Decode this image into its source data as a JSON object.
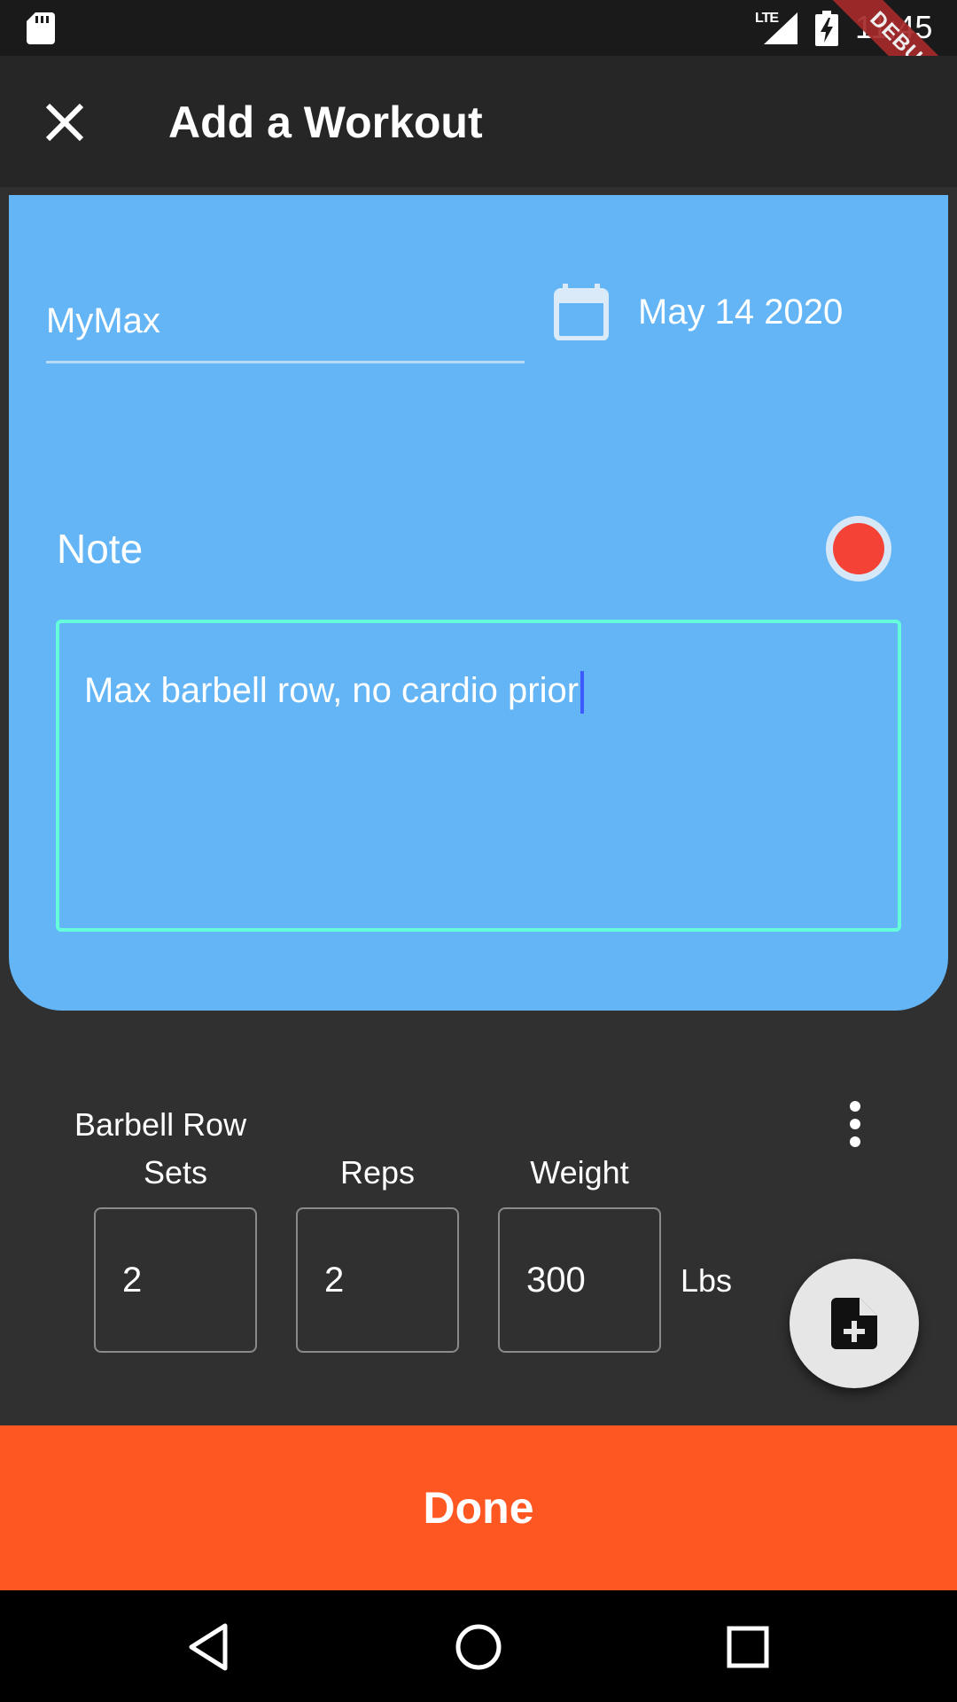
{
  "status_bar": {
    "network": "LTE",
    "time": "11:45",
    "debug_banner": "DEBUG"
  },
  "app_bar": {
    "title": "Add a Workout",
    "close_icon": "close-icon"
  },
  "workout": {
    "name": "MyMax",
    "date": "May 14 2020",
    "calendar_icon": "calendar-icon"
  },
  "note": {
    "label": "Note",
    "text": "Max barbell row, no cardio prior",
    "record_color": "#f44336"
  },
  "exercise": {
    "name": "Barbell Row",
    "columns": [
      "Sets",
      "Reps",
      "Weight"
    ],
    "sets": "2",
    "reps": "2",
    "weight": "300",
    "unit": "Lbs"
  },
  "actions": {
    "done_label": "Done",
    "add_note_icon": "note-add-icon",
    "more_icon": "more-vert-icon"
  },
  "colors": {
    "card": "#64b5f6",
    "done": "#ff5722",
    "note_border": "#64ffda",
    "background": "#303030"
  }
}
